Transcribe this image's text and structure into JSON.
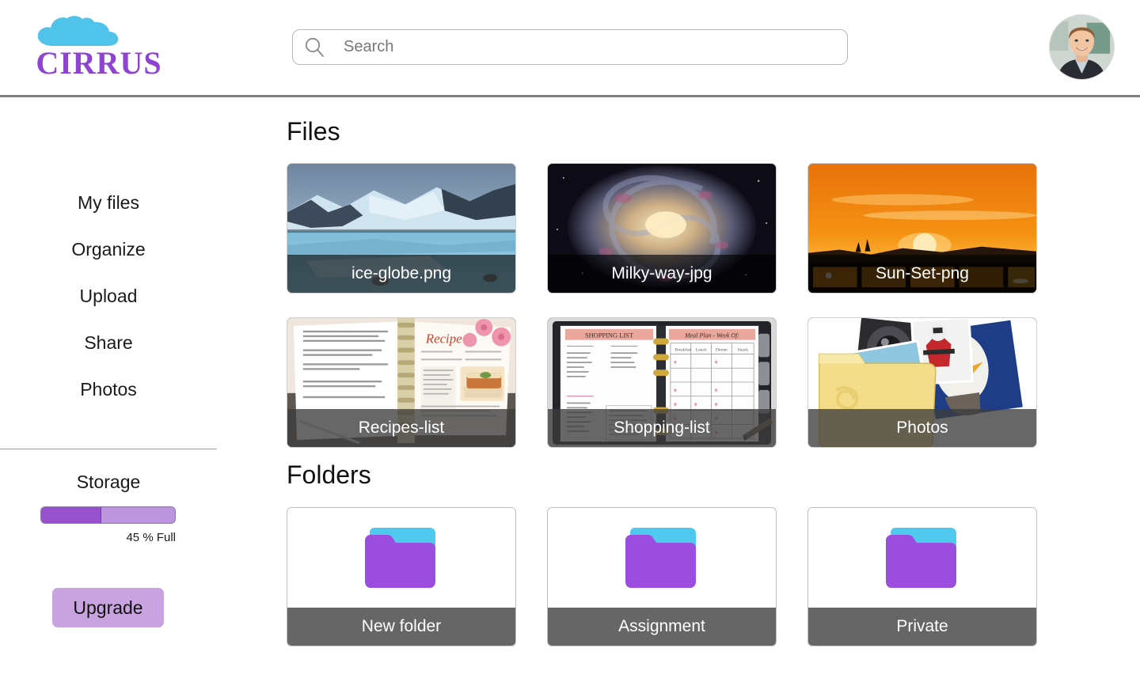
{
  "brand": {
    "name": "CIRRUS",
    "logo_icon": "cloud-icon",
    "logo_color": "#8E44D0",
    "cloud_color": "#4FC3EA"
  },
  "search": {
    "placeholder": "Search",
    "value": "",
    "icon": "search-icon"
  },
  "account": {
    "avatar_icon": "user-avatar-photo"
  },
  "sidebar": {
    "items": [
      {
        "label": "My files"
      },
      {
        "label": "Organize"
      },
      {
        "label": "Upload"
      },
      {
        "label": "Share"
      },
      {
        "label": "Photos"
      }
    ],
    "storage": {
      "title": "Storage",
      "percent": 45,
      "label": "45 % Full",
      "fill_color": "#9552CC",
      "track_color": "#BB96DE"
    },
    "upgrade_label": "Upgrade"
  },
  "main": {
    "files_heading": "Files",
    "folders_heading": "Folders",
    "files": [
      {
        "name": "ice-globe.png",
        "thumb": "ice-glacier-photo",
        "caption_style": "dark"
      },
      {
        "name": "Milky-way-jpg",
        "thumb": "galaxy-spiral-photo",
        "caption_style": "dark"
      },
      {
        "name": "Sun-Set-png",
        "thumb": "sunset-photo",
        "caption_style": "dark"
      },
      {
        "name": "Recipes-list",
        "thumb": "recipe-book-photo",
        "caption_style": "gray"
      },
      {
        "name": "Shopping-list",
        "thumb": "planner-notebook-photo",
        "caption_style": "gray"
      },
      {
        "name": "Photos",
        "thumb": "photo-folder-stack",
        "caption_style": "gray"
      }
    ],
    "folders": [
      {
        "name": "New folder",
        "icon": "folder-icon"
      },
      {
        "name": "Assignment",
        "icon": "folder-icon"
      },
      {
        "name": "Private",
        "icon": "folder-icon"
      }
    ],
    "folder_colors": {
      "front": "#9B4DE0",
      "tab": "#4FC9EE"
    }
  }
}
